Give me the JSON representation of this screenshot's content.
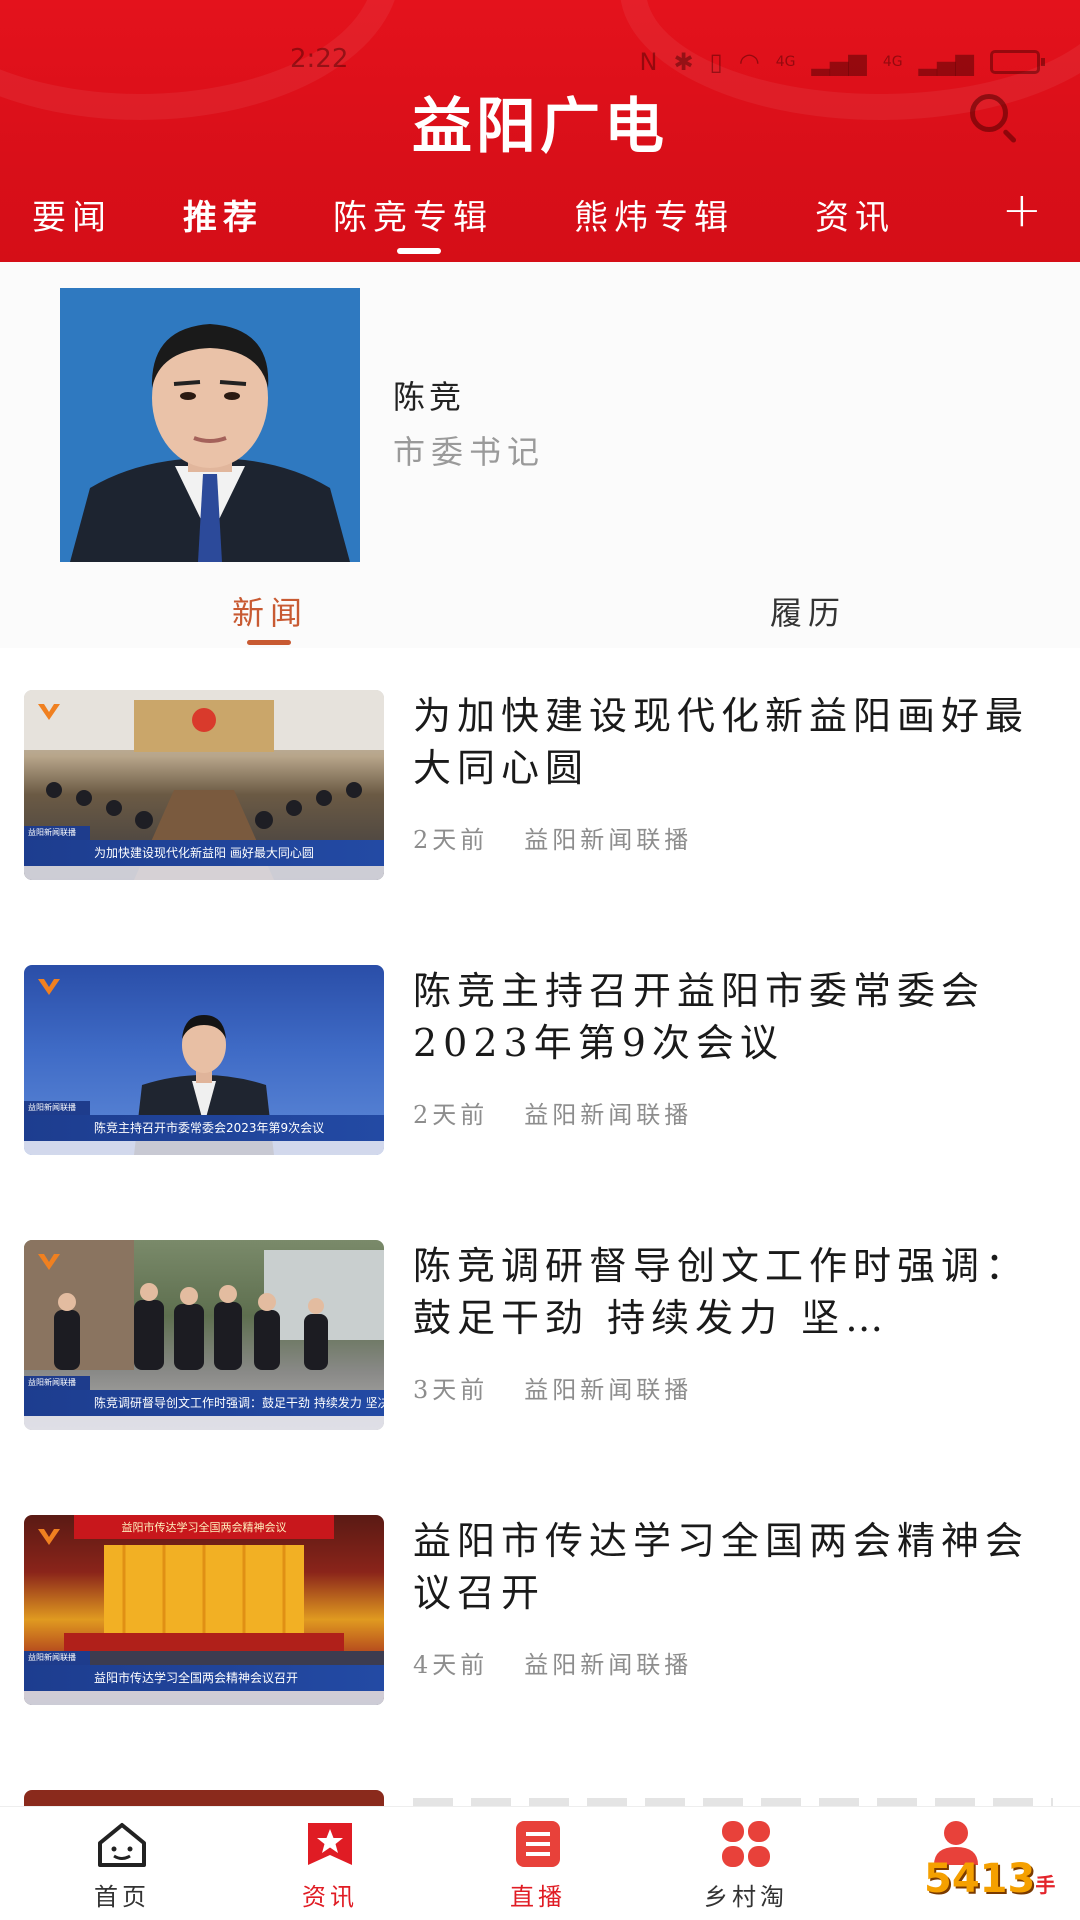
{
  "status_bar": {
    "time": "2:22",
    "network_1": "4G",
    "network_2": "4G"
  },
  "header": {
    "app_title": "益阳广电"
  },
  "tabs": [
    {
      "label": "要闻"
    },
    {
      "label": "推荐"
    },
    {
      "label": "陈竞专辑"
    },
    {
      "label": "熊炜专辑"
    },
    {
      "label": "资讯"
    }
  ],
  "tab_add": "+",
  "profile": {
    "name": "陈竞",
    "title": "市委书记"
  },
  "subtabs": {
    "news": "新闻",
    "resume": "履历"
  },
  "news": [
    {
      "title": "为加快建设现代化新益阳画好最大同心圆",
      "time": "2天前",
      "source": "益阳新闻联播",
      "thumb_caption": "为加快建设现代化新益阳 画好最大同心圆",
      "thumb_tag": "益阳新闻联播"
    },
    {
      "title": "陈竞主持召开益阳市委常委会2023年第9次会议",
      "time": "2天前",
      "source": "益阳新闻联播",
      "thumb_caption": "陈竞主持召开市委常委会2023年第9次会议",
      "thumb_tag": "益阳新闻联播"
    },
    {
      "title": "陈竞调研督导创文工作时强调：鼓足干劲 持续发力 坚…",
      "time": "3天前",
      "source": "益阳新闻联播",
      "thumb_caption": "陈竞调研督导创文工作时强调：鼓足干劲 持续发力 坚决打赢创建全国文明城市攻坚战",
      "thumb_tag": "益阳新闻联播"
    },
    {
      "title": "益阳市传达学习全国两会精神会议召开",
      "time": "4天前",
      "source": "益阳新闻联播",
      "thumb_caption": "益阳市传达学习全国两会精神会议召开",
      "thumb_tag": "益阳新闻联播",
      "thumb_banner": "益阳市传达学习全国两会精神会议"
    }
  ],
  "bottom_nav": [
    {
      "label": "首页",
      "icon": "home-icon"
    },
    {
      "label": "资讯",
      "icon": "star-icon"
    },
    {
      "label": "直播",
      "icon": "live-list-icon"
    },
    {
      "label": "乡村淘",
      "icon": "clover-icon"
    },
    {
      "label": "",
      "icon": "profile-icon"
    }
  ],
  "watermark": {
    "text": "5413",
    "sub": "手游网"
  },
  "colors": {
    "brand_red": "#e01c24",
    "accent_orange": "#c85a32",
    "meta_gray": "#8d8d8d"
  }
}
